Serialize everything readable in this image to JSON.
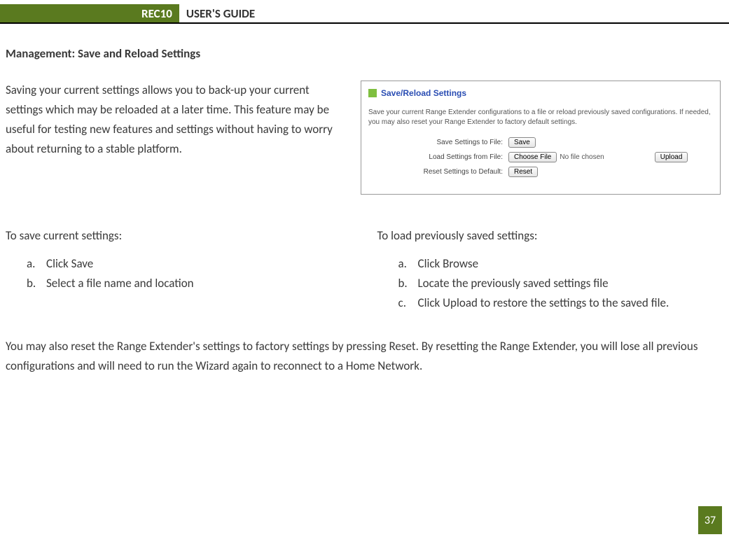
{
  "header": {
    "badge": "REC10",
    "title": "USER'S GUIDE"
  },
  "section_title": "Management: Save and Reload Settings",
  "intro": "Saving your current settings allows you to back-up your current settings which may be reloaded at a later time. This feature may be useful for testing new features and settings without having to worry about returning to a stable platform.",
  "widget": {
    "title": "Save/Reload Settings",
    "desc": "Save your current Range Extender configurations to a file or reload previously saved configurations. If needed, you may also reset your Range Extender to factory default settings.",
    "rows": {
      "save_label": "Save Settings to File:",
      "save_btn": "Save",
      "load_label": "Load Settings from File:",
      "choose_btn": "Choose File",
      "no_file": "No file chosen",
      "upload_btn": "Upload",
      "reset_label": "Reset Settings to Default:",
      "reset_btn": "Reset"
    }
  },
  "save_col": {
    "heading": "To save current settings:",
    "items": [
      "Click Save",
      "Select a file name and location"
    ]
  },
  "load_col": {
    "heading": "To load previously saved settings:",
    "items": [
      "Click Browse",
      "Locate the previously saved settings file",
      "Click Upload to restore the settings to the saved file."
    ]
  },
  "reset_para": "You may also reset the Range Extender's settings to factory settings by pressing Reset.  By resetting the Range Extender, you will lose all previous configurations and will need to run the Wizard again to reconnect to a Home Network.",
  "page_number": "37",
  "markers": [
    "a.",
    "b.",
    "c."
  ]
}
